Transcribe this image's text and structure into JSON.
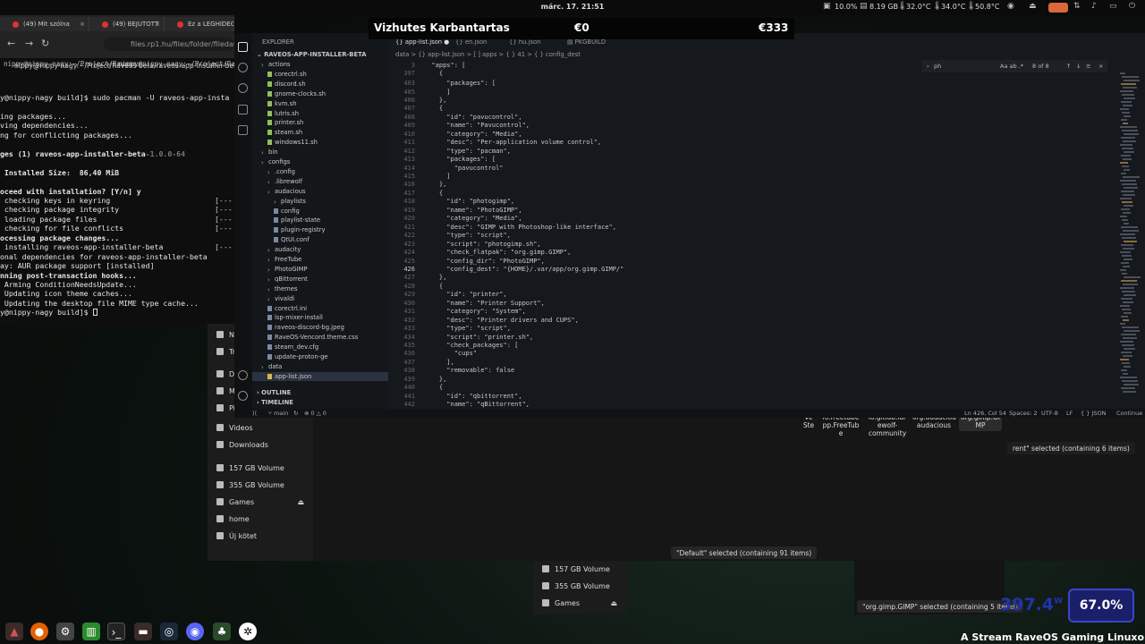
{
  "topbar": {
    "clock": "márc. 17.  21:51",
    "stats": [
      "10.0%",
      "8.19 GB",
      "32.0°C",
      "34.0°C",
      "50.8°C"
    ]
  },
  "browser": {
    "tabs": [
      "(49) Mit szólna",
      "(49) BEJUTOTT",
      "Ez a LEGHIDEG"
    ],
    "url": "files.rp1.hu/files/folder/filedata"
  },
  "terminal": {
    "tabs": [
      "nippy@nippy-nagy:~/Project/Raveos-",
      "nippy@nippy-nagy:~/Project/Raveos-"
    ],
    "title": "nippy@nippy-nagy:~/Project/Raveos-beta/raveos-app-installer-beta",
    "lines": [
      {
        "t": "y@nippy-nagy build]$ sudo pacman -U raveos-app-insta",
        "b": false
      },
      {
        "t": "",
        "b": false
      },
      {
        "t": "ing packages...",
        "b": false
      },
      {
        "t": "ving dependencies...",
        "b": false
      },
      {
        "t": "ng for conflicting packages...",
        "b": false
      },
      {
        "t": "",
        "b": false
      },
      {
        "t": "ges (1) raveos-app-installer-beta",
        "gray": "-1.0.0-64",
        "b": true
      },
      {
        "t": "",
        "b": false
      },
      {
        "t": " Installed Size:  86,40 MiB",
        "b": true
      },
      {
        "t": "",
        "b": false
      },
      {
        "t": "oceed with installation? [Y/n] y",
        "b": true
      },
      {
        "t": " checking keys in keyring",
        "b": false
      },
      {
        "t": " checking package integrity",
        "b": false
      },
      {
        "t": " loading package files",
        "b": false
      },
      {
        "t": " checking for file conflicts",
        "b": false
      },
      {
        "t": "ocessing package changes...",
        "b": true
      },
      {
        "t": " installing raveos-app-installer-beta",
        "b": false
      },
      {
        "t": "raveos-app-installer-beta",
        "b": false,
        "pre": "onal dependencies for "
      },
      {
        "t": "ay: AUR package support [installed]",
        "b": false
      },
      {
        "t": "nning post-transaction hooks...",
        "b": true
      },
      {
        "t": " Arming ConditionNeedsUpdate...",
        "b": false
      },
      {
        "t": " Updating icon theme caches...",
        "b": false
      },
      {
        "t": " Updating the desktop file MIME type cache...",
        "b": false
      },
      {
        "t": "y@nippy-nagy build]$ ",
        "b": false
      }
    ],
    "bars": [
      "[---",
      "[---",
      "[---",
      "[---",
      "[---"
    ]
  },
  "vscode": {
    "menu": [
      "File",
      "Edit",
      "Selection",
      "View",
      "Go",
      "Run"
    ],
    "explorer_title": "EXPLORER",
    "project": "RAVEOS-APP-INSTALLER-BETA",
    "tree": [
      {
        "n": "actions",
        "d": 0,
        "dir": true
      },
      {
        "n": "corectrl.sh",
        "d": 1
      },
      {
        "n": "discord.sh",
        "d": 1
      },
      {
        "n": "gnome-clocks.sh",
        "d": 1
      },
      {
        "n": "kvm.sh",
        "d": 1
      },
      {
        "n": "lutris.sh",
        "d": 1
      },
      {
        "n": "printer.sh",
        "d": 1
      },
      {
        "n": "steam.sh",
        "d": 1
      },
      {
        "n": "windows11.sh",
        "d": 1
      },
      {
        "n": "bin",
        "d": 0,
        "dir": true
      },
      {
        "n": "configs",
        "d": 0,
        "dir": true
      },
      {
        "n": ".config",
        "d": 1,
        "dir": true
      },
      {
        "n": ".librewolf",
        "d": 1,
        "dir": true
      },
      {
        "n": "audacious",
        "d": 1,
        "dir": true
      },
      {
        "n": "playlists",
        "d": 2,
        "dir": true
      },
      {
        "n": "config",
        "d": 2
      },
      {
        "n": "playlist-state",
        "d": 2
      },
      {
        "n": "plugin-registry",
        "d": 2
      },
      {
        "n": "QtUI.conf",
        "d": 2
      },
      {
        "n": "audacity",
        "d": 1,
        "dir": true
      },
      {
        "n": "FreeTube",
        "d": 1,
        "dir": true
      },
      {
        "n": "PhotoGIMP",
        "d": 1,
        "dir": true
      },
      {
        "n": "qBittorrent",
        "d": 1,
        "dir": true
      },
      {
        "n": "themes",
        "d": 1,
        "dir": true
      },
      {
        "n": "vivaldi",
        "d": 1,
        "dir": true
      },
      {
        "n": "corectrl.ini",
        "d": 1
      },
      {
        "n": "lsp-mixer-install",
        "d": 1
      },
      {
        "n": "raveos-discord-bg.jpeg",
        "d": 1
      },
      {
        "n": "RaveOS-Vencord.theme.css",
        "d": 1
      },
      {
        "n": "steam_dev.cfg",
        "d": 1
      },
      {
        "n": "update-proton-ge",
        "d": 1
      },
      {
        "n": "data",
        "d": 0,
        "dir": true
      },
      {
        "n": "app-list.json",
        "d": 1
      }
    ],
    "outline": "OUTLINE",
    "timeline": "TIMELINE",
    "tabs": [
      "app-list.json",
      "en.json",
      "hu.json",
      "PKGBUILD"
    ],
    "breadcrumbs": "data  >  {} app-list.json  >  [ ] apps  >  { } 41  >  { } config_dest",
    "find": {
      "query": "ph",
      "count": "8 of 8"
    },
    "code": [
      {
        "n": "3",
        "c": "  \"apps\": ["
      },
      {
        "n": "397",
        "c": "    {"
      },
      {
        "n": "403",
        "c": "      \"packages\": ["
      },
      {
        "n": "405",
        "c": "      ]"
      },
      {
        "n": "406",
        "c": "    },"
      },
      {
        "n": "407",
        "c": "    {"
      },
      {
        "n": "408",
        "c": "      \"id\": \"pavucontrol\","
      },
      {
        "n": "409",
        "c": "      \"name\": \"Pavucontrol\","
      },
      {
        "n": "410",
        "c": "      \"category\": \"Media\","
      },
      {
        "n": "411",
        "c": "      \"desc\": \"Per-application volume control\","
      },
      {
        "n": "412",
        "c": "      \"type\": \"pacman\","
      },
      {
        "n": "413",
        "c": "      \"packages\": ["
      },
      {
        "n": "414",
        "c": "        \"pavucontrol\""
      },
      {
        "n": "415",
        "c": "      ]"
      },
      {
        "n": "416",
        "c": "    },"
      },
      {
        "n": "417",
        "c": "    {"
      },
      {
        "n": "418",
        "c": "      \"id\": \"photogimp\","
      },
      {
        "n": "419",
        "c": "      \"name\": \"PhotoGIMP\","
      },
      {
        "n": "420",
        "c": "      \"category\": \"Media\","
      },
      {
        "n": "421",
        "c": "      \"desc\": \"GIMP with Photoshop-like interface\","
      },
      {
        "n": "422",
        "c": "      \"type\": \"script\","
      },
      {
        "n": "423",
        "c": "      \"script\": \"photogimp.sh\","
      },
      {
        "n": "424",
        "c": "      \"check_flatpak\": \"org.gimp.GIMP\","
      },
      {
        "n": "425",
        "c": "      \"config_dir\": \"PhotoGIMP\","
      },
      {
        "n": "426",
        "c": "      \"config_dest\": \"{HOME}/.var/app/org.gimp.GIMP/\""
      },
      {
        "n": "427",
        "c": "    },"
      },
      {
        "n": "428",
        "c": "    {"
      },
      {
        "n": "429",
        "c": "      \"id\": \"printer\","
      },
      {
        "n": "430",
        "c": "      \"name\": \"Printer Support\","
      },
      {
        "n": "431",
        "c": "      \"category\": \"System\","
      },
      {
        "n": "432",
        "c": "      \"desc\": \"Printer drivers and CUPS\","
      },
      {
        "n": "433",
        "c": "      \"type\": \"script\","
      },
      {
        "n": "434",
        "c": "      \"script\": \"printer.sh\","
      },
      {
        "n": "435",
        "c": "      \"check_packages\": ["
      },
      {
        "n": "436",
        "c": "        \"cups\""
      },
      {
        "n": "437",
        "c": "      ],"
      },
      {
        "n": "438",
        "c": "      \"removable\": false"
      },
      {
        "n": "439",
        "c": "    },"
      },
      {
        "n": "440",
        "c": "    {"
      },
      {
        "n": "441",
        "c": "      \"id\": \"qbittorrent\","
      },
      {
        "n": "442",
        "c": "      \"name\": \"qBittorrent\","
      }
    ],
    "status_left": [
      "main",
      "0 △ 0"
    ],
    "status_right": [
      "Ln 426, Col 54",
      "Spaces: 2",
      "UTF-8",
      "LF",
      "{ } JSON",
      "Continue"
    ]
  },
  "overlay": {
    "title": "Vizhutes Karbantartas",
    "a": "€0",
    "b": "€333"
  },
  "filemanager": {
    "sidebar": [
      "Videos",
      "Downloads",
      "157 GB Volume",
      "355 GB Volume",
      "Games",
      "home",
      "Új kötet"
    ],
    "partial_left": [
      "N",
      "Tr",
      "D",
      "M",
      "Pi"
    ],
    "grid": [
      {
        "label": "ve\nSte"
      },
      {
        "label": "io.freetube\npp.FreeTub\ne"
      },
      {
        "label": "io.gitlab.lar\newolf-\ncommunity"
      },
      {
        "label": "org.audaciou\naudacious"
      },
      {
        "label": "org.gimp.Gi\nMP"
      }
    ],
    "toast_main": "\"Default\" selected  (containing 91 items)",
    "toast_right": "rent\" selected  (containing 6 items)",
    "fm2": [
      "157 GB Volume",
      "355 GB Volume",
      "Games"
    ],
    "toast_gimp": "\"org.gimp.GIMP\" selected  (containing 5 items)"
  },
  "perf": {
    "watts": "397.4",
    "unit": "W",
    "pct": "67.0%"
  },
  "stream_text": "A Stream RaveOS Gaming Linuxon fut"
}
